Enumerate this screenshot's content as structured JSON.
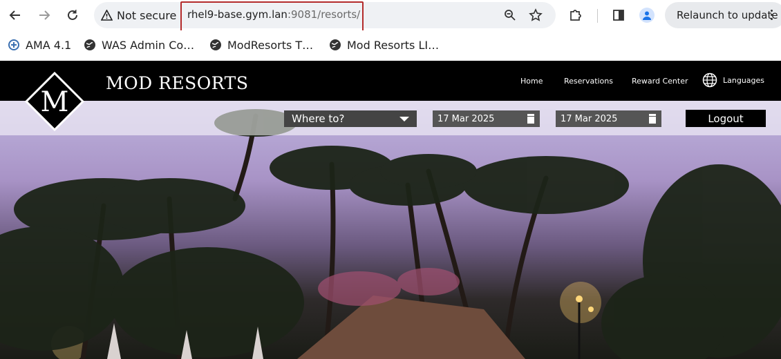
{
  "browser": {
    "security_label": "Not secure",
    "url_host": "rhel9-base.gym.lan",
    "url_rest": ":9081/resorts/",
    "relaunch_label": "Relaunch to update"
  },
  "bookmarks": [
    {
      "label": "AMA 4.1",
      "icon": "ama-icon"
    },
    {
      "label": "WAS Admin Co…",
      "icon": "globe-icon"
    },
    {
      "label": "ModResorts T…",
      "icon": "globe-icon"
    },
    {
      "label": "Mod Resorts LI…",
      "icon": "globe-icon"
    }
  ],
  "site": {
    "brand": "MOD RESORTS",
    "logo_letter": "M",
    "nav": {
      "home": "Home",
      "reservations": "Reservations",
      "reward_center": "Reward Center",
      "languages": "Languages"
    },
    "search": {
      "destination": "Where to?",
      "check_in": "17 Mar 2025",
      "check_out": "17 Mar 2025",
      "logout": "Logout"
    }
  },
  "colors": {
    "url_highlight": "#b32a2a",
    "header_bg": "#000000",
    "select_bg": "#444444"
  }
}
